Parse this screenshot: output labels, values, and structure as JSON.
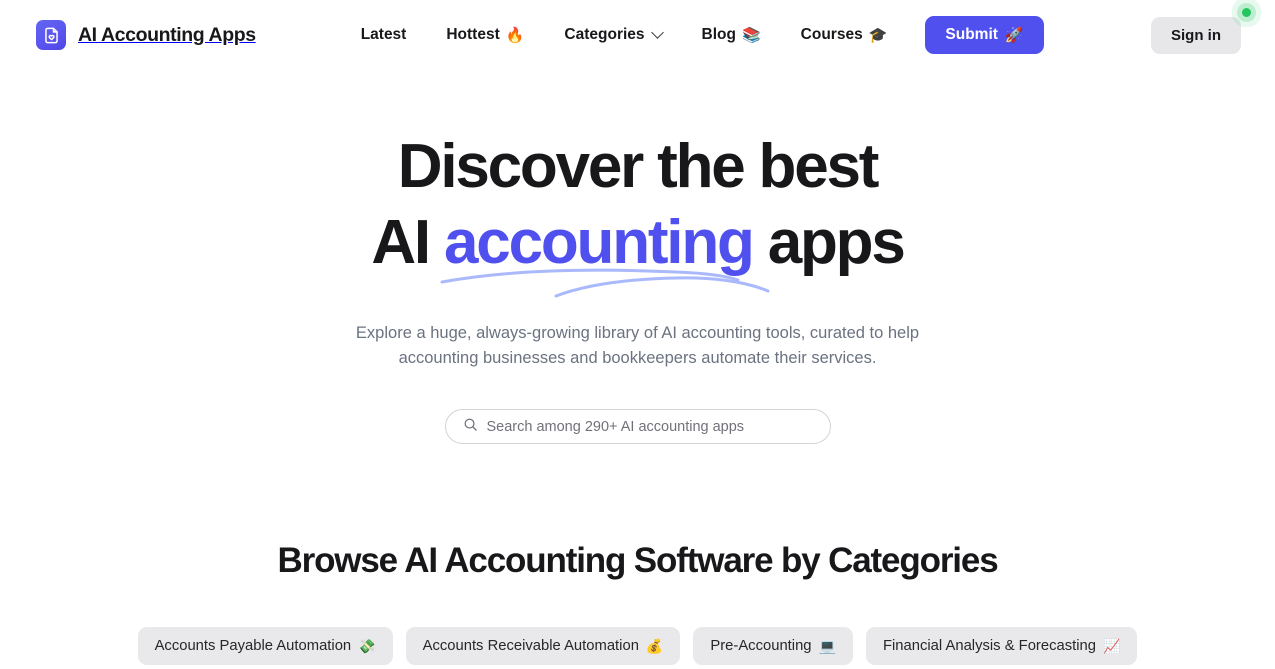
{
  "brand": {
    "name": "AI Accounting Apps",
    "logo_icon": "document-heart-icon"
  },
  "nav": {
    "items": [
      {
        "label": "Latest",
        "emoji": "",
        "icon": "",
        "has_chevron": false
      },
      {
        "label": "Hottest",
        "emoji": "🔥",
        "icon": "fire-icon",
        "has_chevron": false
      },
      {
        "label": "Categories",
        "emoji": "",
        "icon": "chevron-down-icon",
        "has_chevron": true
      },
      {
        "label": "Blog",
        "emoji": "📚",
        "icon": "books-icon",
        "has_chevron": false
      },
      {
        "label": "Courses",
        "emoji": "🎓",
        "icon": "graduation-cap-icon",
        "has_chevron": false
      }
    ],
    "submit": {
      "label": "Submit",
      "emoji": "🚀",
      "icon": "rocket-icon"
    },
    "signin": {
      "label": "Sign in",
      "status_dot_color": "#22c55e"
    }
  },
  "hero": {
    "line1": "Discover the best",
    "line2_prefix": "AI ",
    "line2_accent": "accounting",
    "line2_suffix": " apps",
    "subtitle": "Explore a huge, always-growing library of AI accounting tools, curated to help accounting businesses and bookkeepers automate their services.",
    "accent_color": "#4f50ed",
    "underline_color": "#a5b4fc"
  },
  "search": {
    "placeholder": "Search among 290+ AI accounting apps",
    "value": "",
    "icon": "search-icon"
  },
  "categories": {
    "title": "Browse AI Accounting Software by Categories",
    "chips": [
      {
        "label": "Accounts Payable Automation",
        "emoji": "💸",
        "icon": "money-with-wings-icon"
      },
      {
        "label": "Accounts Receivable Automation",
        "emoji": "💰",
        "icon": "money-bag-icon"
      },
      {
        "label": "Pre-Accounting",
        "emoji": "💻",
        "icon": "laptop-icon"
      },
      {
        "label": "Financial Analysis & Forecasting",
        "emoji": "📈",
        "icon": "chart-increasing-icon"
      }
    ]
  }
}
